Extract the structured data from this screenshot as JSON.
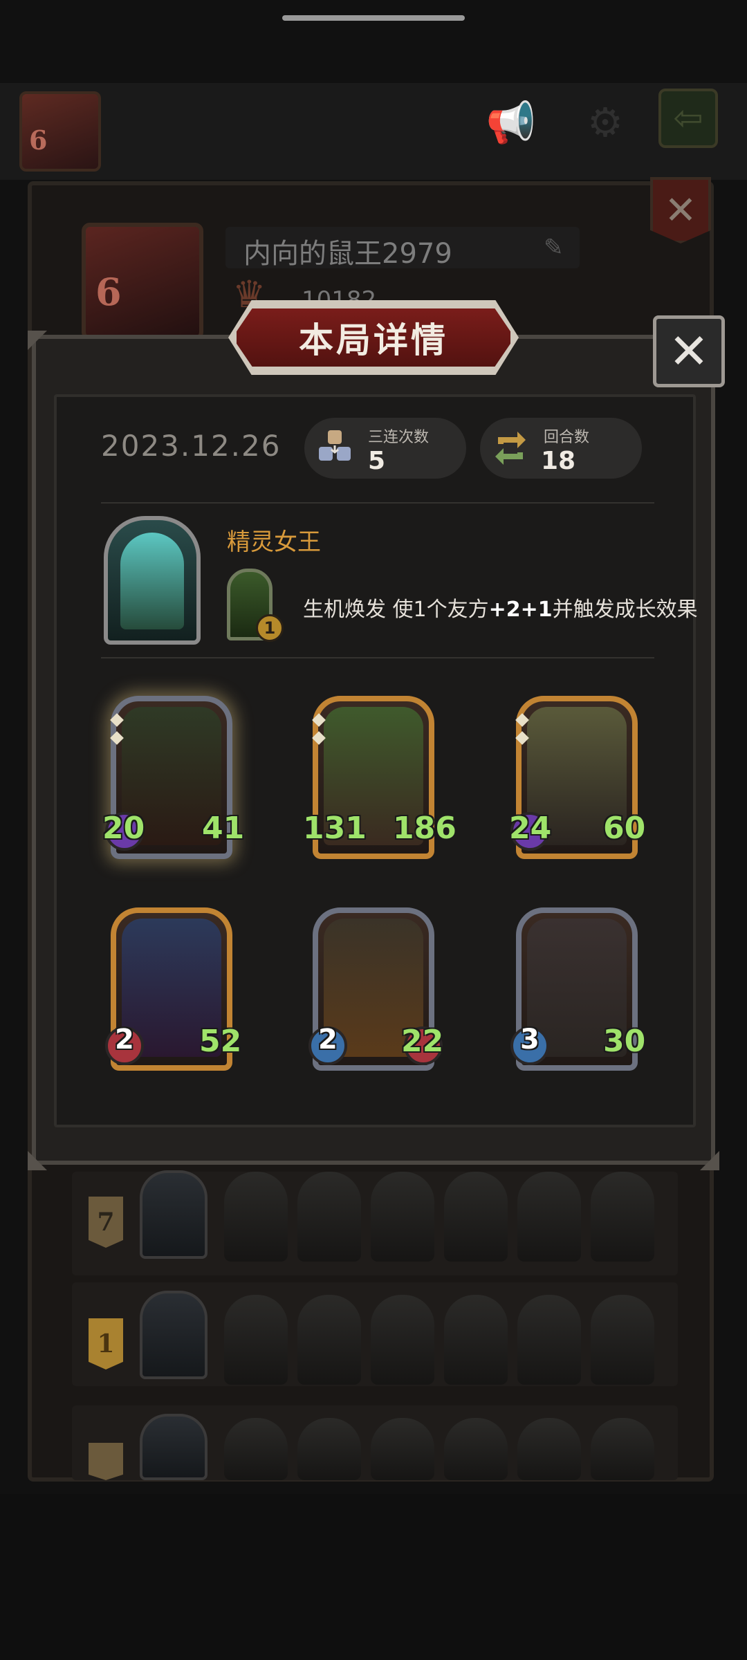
{
  "profile": {
    "level": "6",
    "name": "内向的鼠王2979",
    "score": "10182"
  },
  "modal": {
    "title": "本局详情",
    "date": "2023.12.26",
    "stats": [
      {
        "label": "三连次数",
        "value": "5",
        "icon": "triple-icon"
      },
      {
        "label": "回合数",
        "value": "18",
        "icon": "round-cycle-icon"
      }
    ],
    "hero": {
      "name": "精灵女王",
      "skill_level": "1",
      "skill_name": "生机焕发",
      "skill_desc_pre": "使1个友方",
      "skill_desc_bonus": "+2+1",
      "skill_desc_post": "并触发成长效果"
    },
    "units": [
      {
        "name": "boar",
        "atk": "20",
        "hp": "41",
        "frame": "silver",
        "badge": "purple"
      },
      {
        "name": "leaf-child",
        "atk": "131",
        "hp": "186",
        "frame": "gold",
        "badge": "none"
      },
      {
        "name": "fairy",
        "atk": "24",
        "hp": "60",
        "frame": "gold",
        "badge": "purple"
      },
      {
        "name": "dark-elf",
        "atk": "2",
        "hp": "52",
        "frame": "gold",
        "badge": "red"
      },
      {
        "name": "pumpkin",
        "atk": "2",
        "hp": "22",
        "frame": "silver",
        "badge": "blue"
      },
      {
        "name": "masked-rabbit",
        "atk": "3",
        "hp": "30",
        "frame": "silver",
        "badge": "blue"
      }
    ]
  },
  "history": [
    {
      "rank": "7"
    },
    {
      "rank": "1"
    },
    {
      "rank": ""
    }
  ],
  "colors": {
    "accent_gold": "#d89a3b",
    "banner_red": "#7a1d1a",
    "stat_green": "#9fe36a"
  }
}
